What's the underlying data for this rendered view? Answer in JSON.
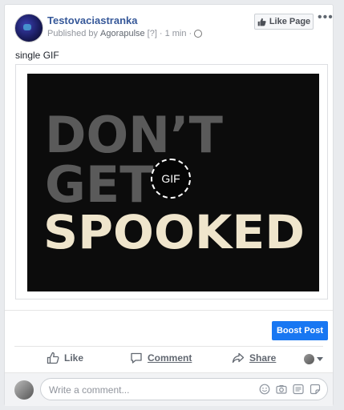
{
  "post": {
    "page_name": "Testovaciastranka",
    "published_by_prefix": "Published by",
    "publisher": "Agorapulse",
    "help_mark": "[?]",
    "separator": "·",
    "time": "1 min",
    "separator2": "·",
    "like_page_label": "Like Page",
    "more_label": "•••",
    "text": "single GIF"
  },
  "gif": {
    "line1": "DON’T",
    "line2": "GET",
    "line3": "SPOOKED",
    "badge": "GIF"
  },
  "boost_label": "Boost Post",
  "actions": {
    "like": "Like",
    "comment": "Comment",
    "share": "Share"
  },
  "comment_box": {
    "placeholder": "Write a comment..."
  },
  "colors": {
    "link": "#365899",
    "boost": "#1877f2"
  }
}
